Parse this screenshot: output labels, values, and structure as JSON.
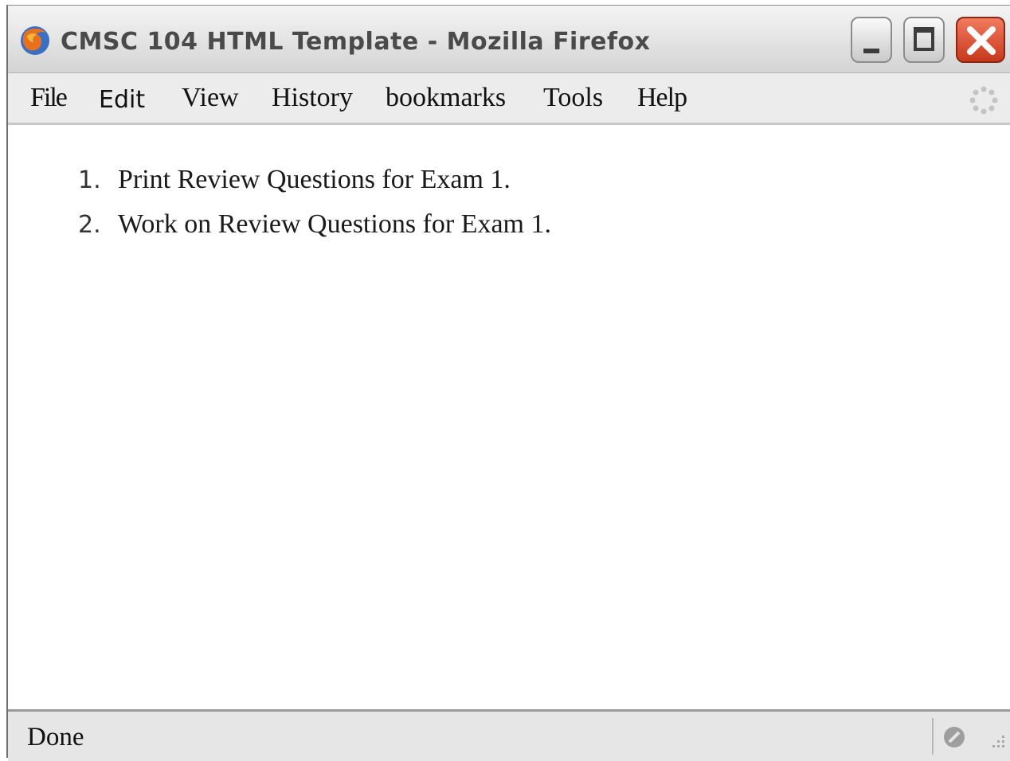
{
  "window": {
    "title": "CMSC 104 HTML Template - Mozilla Firefox"
  },
  "menu": {
    "items": [
      {
        "label": "File"
      },
      {
        "label": "Edit"
      },
      {
        "label": "View"
      },
      {
        "label": "History"
      },
      {
        "label": "bookmarks"
      },
      {
        "label": "Tools"
      },
      {
        "label": "Help"
      }
    ]
  },
  "content": {
    "list": [
      {
        "number": "1.",
        "text": "Print Review Questions for Exam 1."
      },
      {
        "number": "2.",
        "text": "Work on Review Questions for Exam 1."
      }
    ]
  },
  "status": {
    "text": "Done"
  },
  "icons": {
    "app": "firefox-logo-icon",
    "minimize": "minimize-icon",
    "maximize": "maximize-icon",
    "close": "close-icon",
    "throbber": "throbber-icon",
    "status": "security-status-icon",
    "grip": "resize-grip-icon"
  },
  "colors": {
    "close_button": "#d4472a",
    "titlebar": "#e6e6e6",
    "menubar": "#ececec",
    "statusbar": "#e6e6e6"
  }
}
